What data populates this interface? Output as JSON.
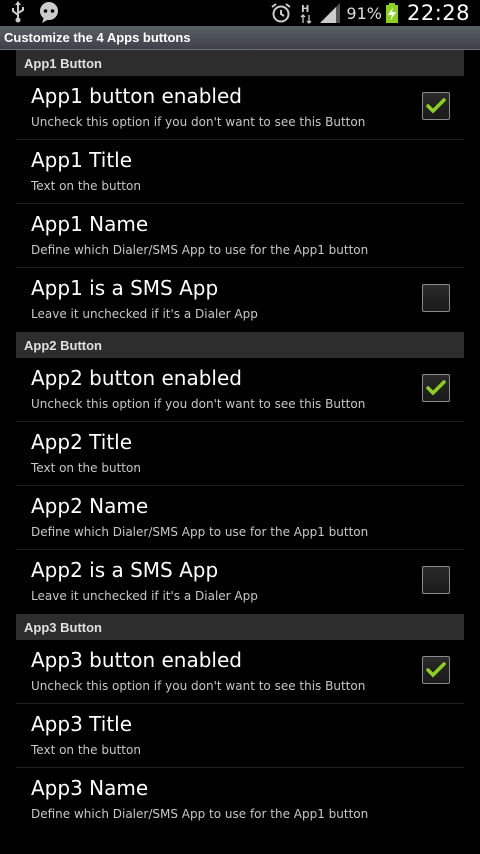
{
  "status_bar": {
    "left_icons": [
      "usb-icon",
      "chat-bubble-icon"
    ],
    "right_icons": [
      "alarm-icon",
      "network-h-icon",
      "signal-icon"
    ],
    "battery_percent": "91%",
    "time": "22:28"
  },
  "window": {
    "title": "Customize the 4 Apps buttons"
  },
  "colors": {
    "check_green": "#8cd020",
    "category_bg": "#2d2d2d",
    "title_bar_bg": "#4a4e54"
  },
  "sections": [
    {
      "header": "App1 Button",
      "items": [
        {
          "title": "App1 button enabled",
          "summary": "Uncheck this option if you don't want to see this Button",
          "checked": true
        },
        {
          "title": "App1 Title",
          "summary": "Text on the button"
        },
        {
          "title": "App1 Name",
          "summary": "Define which Dialer/SMS App to use for the App1 button"
        },
        {
          "title": "App1 is a SMS App",
          "summary": "Leave it unchecked if it's a Dialer App",
          "checked": false
        }
      ]
    },
    {
      "header": "App2 Button",
      "items": [
        {
          "title": "App2 button enabled",
          "summary": "Uncheck this option if you don't want to see this Button",
          "checked": true
        },
        {
          "title": "App2 Title",
          "summary": "Text on the button"
        },
        {
          "title": "App2 Name",
          "summary": "Define which Dialer/SMS App to use for the App1 button"
        },
        {
          "title": "App2 is a SMS App",
          "summary": "Leave it unchecked if it's a Dialer App",
          "checked": false
        }
      ]
    },
    {
      "header": "App3 Button",
      "items": [
        {
          "title": "App3 button enabled",
          "summary": "Uncheck this option if you don't want to see this Button",
          "checked": true
        },
        {
          "title": "App3 Title",
          "summary": "Text on the button"
        },
        {
          "title": "App3 Name",
          "summary": "Define which Dialer/SMS App to use for the App1 button"
        }
      ]
    }
  ]
}
